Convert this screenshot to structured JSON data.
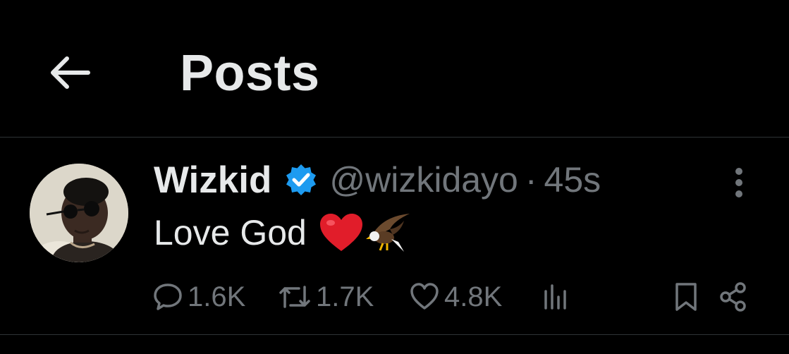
{
  "header": {
    "title": "Posts",
    "back_icon": "arrow-left-icon"
  },
  "post": {
    "author": {
      "display_name": "Wizkid",
      "handle": "@wizkidayo",
      "verified": true,
      "verified_color": "#1d9bf0"
    },
    "separator": "·",
    "timestamp": "45s",
    "text": "Love God",
    "emojis": [
      "red-heart-emoji",
      "eagle-emoji"
    ],
    "actions": {
      "replies": "1.6K",
      "reposts": "1.7K",
      "likes": "4.8K"
    }
  },
  "colors": {
    "background": "#000000",
    "text_primary": "#e7e9ea",
    "text_secondary": "#71767b",
    "divider": "#2f3336",
    "accent": "#1d9bf0"
  }
}
